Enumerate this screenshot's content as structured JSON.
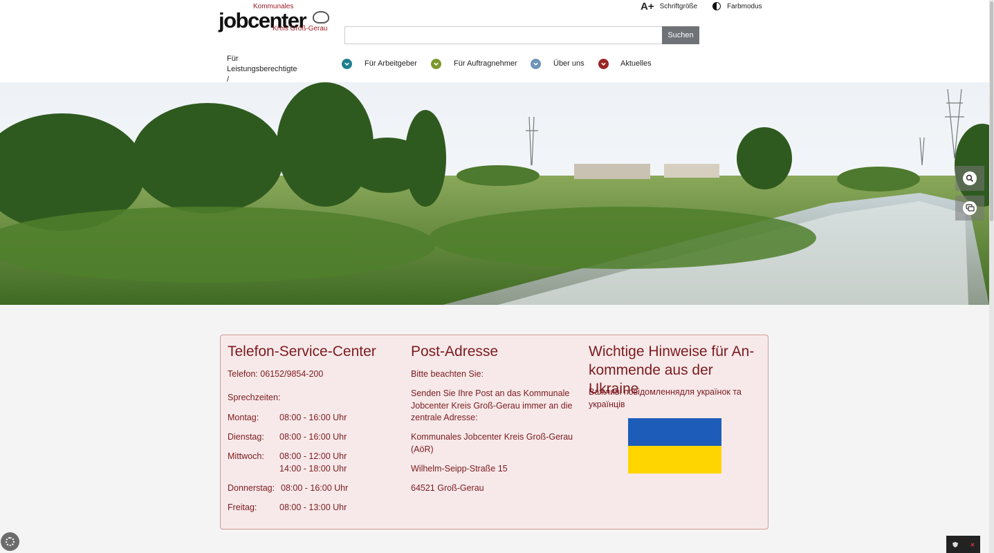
{
  "header": {
    "logo": {
      "line1": "Kommunales",
      "line2": "jobcenter",
      "line3": "Kreis Groß-Gerau"
    },
    "tools": {
      "font_size_icon": "A+",
      "font_size_label": "Schriftgröße",
      "color_mode_label": "Farbmodus"
    },
    "search": {
      "placeholder": "",
      "button_label": "Suchen"
    },
    "nav": [
      {
        "label": "Für Leistungsberechtigte /\nArbeitsuchende",
        "icon": "chevron-down-icon",
        "color": "#1f7f8f"
      },
      {
        "label": "Für Arbeitgeber",
        "icon": "chevron-down-icon",
        "color": "#7a9a2c"
      },
      {
        "label": "Für Auftragnehmer",
        "icon": "chevron-down-icon",
        "color": "#6e93b8"
      },
      {
        "label": "Über uns",
        "icon": "chevron-down-icon",
        "color": "#9b2323"
      },
      {
        "label": "Aktuelles",
        "icon": "",
        "color": ""
      }
    ]
  },
  "hero": {
    "image": "landscape with meadow, trees and a stream",
    "side_buttons": [
      "search-icon",
      "chat-icon"
    ]
  },
  "info": {
    "telefon": {
      "title": "Telefon-Service-Center",
      "phone": "Telefon: 06152/9854-200",
      "hours_label": "Sprechzeiten:",
      "hours": [
        {
          "day": "Montag:",
          "time": "08:00 - 16:00 Uhr"
        },
        {
          "day": "Dienstag:",
          "time": "08:00 - 16:00 Uhr"
        },
        {
          "day": "Mittwoch:",
          "time": "08:00 - 12:00 Uhr",
          "time2": "14:00 - 18:00 Uhr"
        },
        {
          "day": "Donnerstag:",
          "time": "08:00 - 16:00 Uhr"
        },
        {
          "day": "Freitag:",
          "time": "08:00 - 13:00 Uhr"
        }
      ]
    },
    "post": {
      "title": "Post-Adresse",
      "note": "Bitte beachten Sie:",
      "intro": "Senden Sie Ihre Post an das Kommunale Jobcenter Kreis Groß-Gerau immer an die zentrale Adresse:",
      "org": "Kommunales Jobcenter Kreis Groß-Gerau (AöR)",
      "street": "Wilhelm-Seipp-Straße 15",
      "city": "64521 Groß-Gerau"
    },
    "ukraine": {
      "title": "Wichtige Hinweise für An-kommende aus der Ukraine",
      "text": "Важливі повідомленнядля українок та українців",
      "flag_colors": [
        "#1e5cba",
        "#ffd500"
      ]
    }
  },
  "colors": {
    "accent": "#7b1a1f",
    "panel_bg": "#f7e9e9",
    "panel_border": "#cf9a9a"
  }
}
